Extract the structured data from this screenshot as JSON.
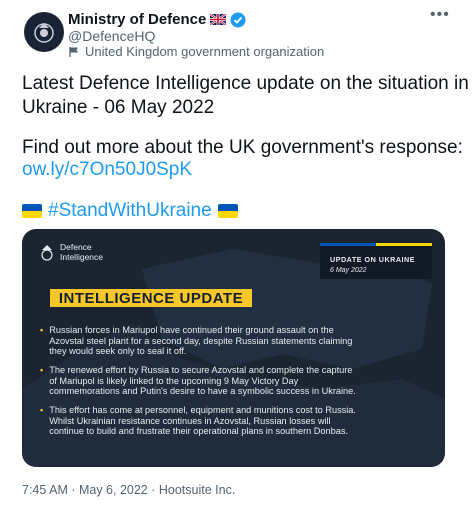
{
  "author": {
    "name": "Ministry of Defence",
    "handle": "@DefenceHQ",
    "affiliation": "United Kingdom government organization",
    "flag_emoji": "🇬🇧"
  },
  "tweet": {
    "line1": "Latest Defence Intelligence update on the situation in",
    "line2": "Ukraine - 06 May 2022",
    "line3": "Find out more about the UK government's response:",
    "link": "ow.ly/c7On50J0SpK",
    "hashtag": "#StandWithUkraine",
    "flag_emoji": "🇺🇦"
  },
  "card": {
    "logo_line1": "Defence",
    "logo_line2": "Intelligence",
    "update_title": "UPDATE ON UKRAINE",
    "update_date": "6 May 2022",
    "banner": "INTELLIGENCE UPDATE",
    "bullets": [
      [
        "Russian forces in Mariupol have continued their ground assault on the",
        "Azovstal steel plant for a second day, despite Russian statements claiming",
        "they would seek only to seal it off."
      ],
      [
        "The renewed effort by Russia to secure Azovstal and complete the capture",
        "of Mariupol is likely linked to the upcoming 9 May Victory Day",
        "commemorations and Putin's desire to have a symbolic success in Ukraine."
      ],
      [
        "This effort has come at personnel, equipment and munitions cost to Russia.",
        "Whilst Ukrainian resistance continues in Azovstal, Russian losses will",
        "continue to build and frustrate their operational plans in southern Donbas."
      ]
    ]
  },
  "meta": {
    "timestamp": "7:45 AM · May 6, 2022 · Hootsuite Inc."
  },
  "colors": {
    "link": "#1d9bf0",
    "banner": "#f6c62b",
    "card_bg": "#1b2532",
    "verified": "#1d9bf0"
  }
}
